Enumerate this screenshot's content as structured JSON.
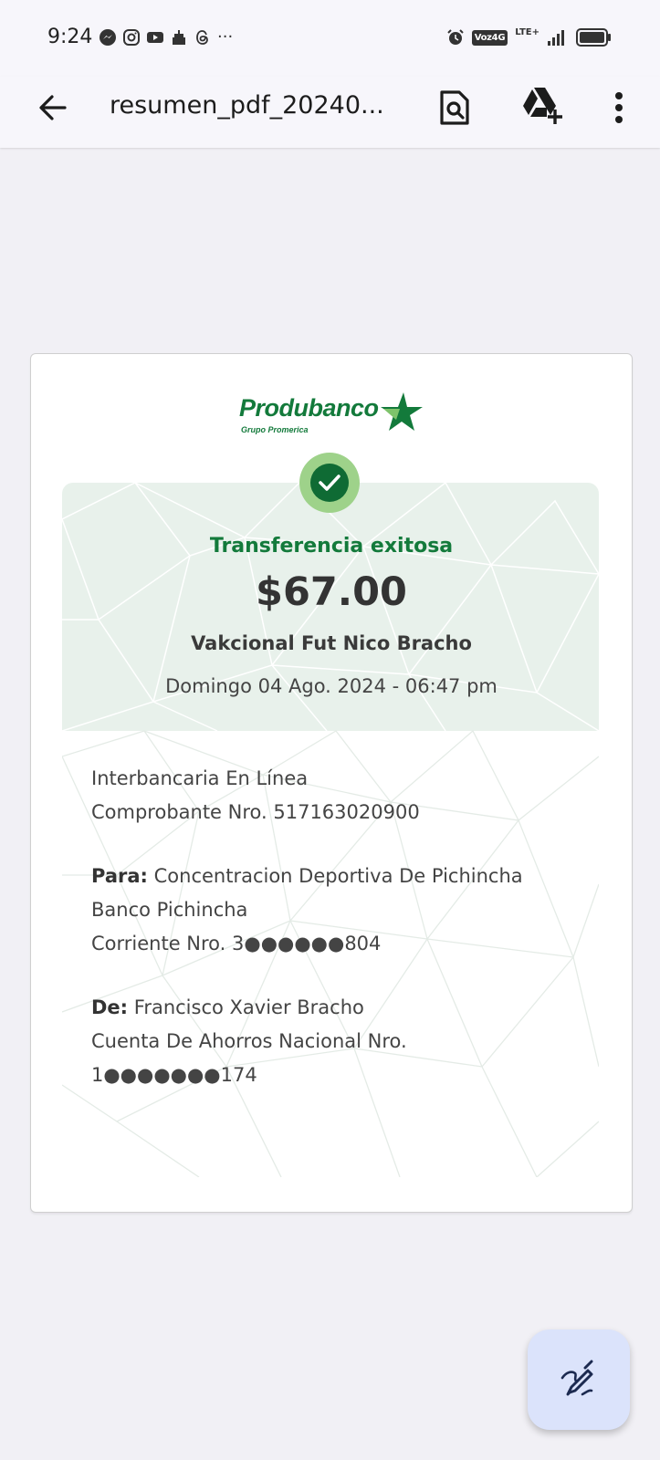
{
  "status_bar": {
    "time": "9:24",
    "overflow": "···",
    "network_badge": "Voz4G",
    "lte": "LTE+",
    "icons_left": [
      "messenger-icon",
      "instagram-icon",
      "youtube-icon",
      "cake-icon",
      "threads-icon"
    ],
    "icons_right": [
      "alarm-icon",
      "signal-icon",
      "battery-icon"
    ]
  },
  "app_bar": {
    "file_title": "resumen_pdf_20240..."
  },
  "receipt": {
    "brand_name": "Produbanco",
    "brand_sub": "Grupo Promerica",
    "status": "Transferencia exitosa",
    "amount": "$67.00",
    "description": "Vakcional Fut Nico Bracho",
    "datetime": "Domingo 04 Ago. 2024 - 06:47 pm",
    "transfer_type": "Interbancaria En Línea",
    "voucher": "Comprobante Nro. 517163020900",
    "to_label": "Para:",
    "to_name": "Concentracion Deportiva De Pichincha",
    "to_bank": "Banco Pichincha",
    "to_account": "Corriente Nro. 3●●●●●●804",
    "from_label": "De:",
    "from_name": "Francisco Xavier Bracho",
    "from_account_type": "Cuenta De Ahorros Nacional Nro.",
    "from_account": "1●●●●●●●174"
  },
  "colors": {
    "brand_green": "#137a3b",
    "check_light": "#9ed28a",
    "check_dark": "#0f6b34",
    "pattern_bg": "#e8f1eb",
    "fab_bg": "#dbe3fb"
  }
}
